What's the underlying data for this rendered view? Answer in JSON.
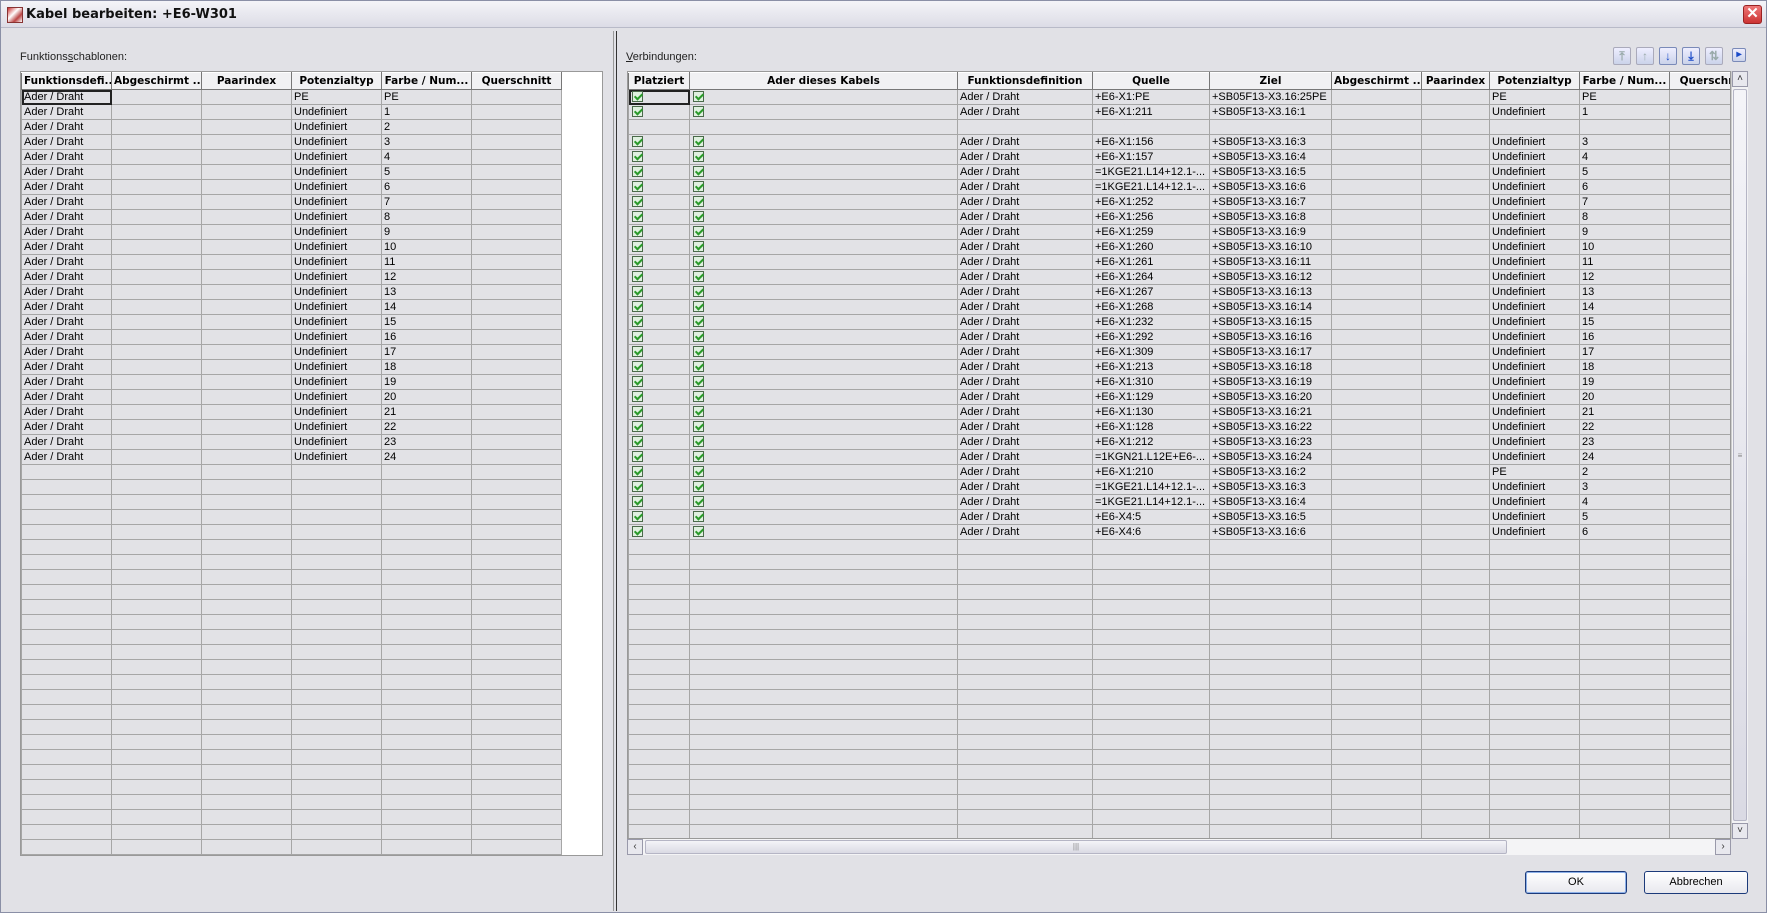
{
  "window": {
    "title": "Kabel bearbeiten: +E6-W301",
    "close_icon": "close-icon"
  },
  "left": {
    "label_pre": "Funktions",
    "label_accel": "s",
    "label_post": "chablonen:",
    "columns": [
      "Funktionsdefi...",
      "Abgeschirmt ...",
      "Paarindex",
      "Potenzialtyp",
      "Farbe / Num...",
      "Querschnitt"
    ],
    "rows": [
      [
        "Ader / Draht",
        "",
        "",
        "PE",
        "PE",
        ""
      ],
      [
        "Ader / Draht",
        "",
        "",
        "Undefiniert",
        "1",
        ""
      ],
      [
        "Ader / Draht",
        "",
        "",
        "Undefiniert",
        "2",
        ""
      ],
      [
        "Ader / Draht",
        "",
        "",
        "Undefiniert",
        "3",
        ""
      ],
      [
        "Ader / Draht",
        "",
        "",
        "Undefiniert",
        "4",
        ""
      ],
      [
        "Ader / Draht",
        "",
        "",
        "Undefiniert",
        "5",
        ""
      ],
      [
        "Ader / Draht",
        "",
        "",
        "Undefiniert",
        "6",
        ""
      ],
      [
        "Ader / Draht",
        "",
        "",
        "Undefiniert",
        "7",
        ""
      ],
      [
        "Ader / Draht",
        "",
        "",
        "Undefiniert",
        "8",
        ""
      ],
      [
        "Ader / Draht",
        "",
        "",
        "Undefiniert",
        "9",
        ""
      ],
      [
        "Ader / Draht",
        "",
        "",
        "Undefiniert",
        "10",
        ""
      ],
      [
        "Ader / Draht",
        "",
        "",
        "Undefiniert",
        "11",
        ""
      ],
      [
        "Ader / Draht",
        "",
        "",
        "Undefiniert",
        "12",
        ""
      ],
      [
        "Ader / Draht",
        "",
        "",
        "Undefiniert",
        "13",
        ""
      ],
      [
        "Ader / Draht",
        "",
        "",
        "Undefiniert",
        "14",
        ""
      ],
      [
        "Ader / Draht",
        "",
        "",
        "Undefiniert",
        "15",
        ""
      ],
      [
        "Ader / Draht",
        "",
        "",
        "Undefiniert",
        "16",
        ""
      ],
      [
        "Ader / Draht",
        "",
        "",
        "Undefiniert",
        "17",
        ""
      ],
      [
        "Ader / Draht",
        "",
        "",
        "Undefiniert",
        "18",
        ""
      ],
      [
        "Ader / Draht",
        "",
        "",
        "Undefiniert",
        "19",
        ""
      ],
      [
        "Ader / Draht",
        "",
        "",
        "Undefiniert",
        "20",
        ""
      ],
      [
        "Ader / Draht",
        "",
        "",
        "Undefiniert",
        "21",
        ""
      ],
      [
        "Ader / Draht",
        "",
        "",
        "Undefiniert",
        "22",
        ""
      ],
      [
        "Ader / Draht",
        "",
        "",
        "Undefiniert",
        "23",
        ""
      ],
      [
        "Ader / Draht",
        "",
        "",
        "Undefiniert",
        "24",
        ""
      ]
    ]
  },
  "right": {
    "label_accel": "V",
    "label_post": "erbindungen:",
    "toolbar": [
      {
        "icon": "move-top-icon",
        "glyph": "⤒",
        "enabled": false
      },
      {
        "icon": "move-up-icon",
        "glyph": "↑",
        "enabled": false
      },
      {
        "icon": "move-down-icon",
        "glyph": "↓",
        "enabled": true
      },
      {
        "icon": "move-bottom-icon",
        "glyph": "⤓",
        "enabled": true
      },
      {
        "icon": "swap-icon",
        "glyph": "⇅",
        "enabled": false
      },
      {
        "icon": "expand-icon",
        "glyph": "▸",
        "enabled": true
      }
    ],
    "columns": [
      "Platziert",
      "Ader dieses Kabels",
      "Funktionsdefinition",
      "Quelle",
      "Ziel",
      "Abgeschirmt ...",
      "Paarindex",
      "Potenzialtyp",
      "Farbe / Num...",
      "Querschnitt"
    ],
    "rows": [
      {
        "platziert": true,
        "ader": true,
        "funk": "Ader / Draht",
        "quelle": "+E6-X1:PE",
        "ziel": "+SB05F13-X3.16:25PE",
        "pot": "PE",
        "farbe": "PE"
      },
      {
        "platziert": true,
        "ader": true,
        "funk": "Ader / Draht",
        "quelle": "+E6-X1:211",
        "ziel": "+SB05F13-X3.16:1",
        "pot": "Undefiniert",
        "farbe": "1"
      },
      {
        "platziert": false,
        "ader": false,
        "funk": "",
        "quelle": "",
        "ziel": "",
        "pot": "",
        "farbe": ""
      },
      {
        "platziert": true,
        "ader": true,
        "funk": "Ader / Draht",
        "quelle": "+E6-X1:156",
        "ziel": "+SB05F13-X3.16:3",
        "pot": "Undefiniert",
        "farbe": "3"
      },
      {
        "platziert": true,
        "ader": true,
        "funk": "Ader / Draht",
        "quelle": "+E6-X1:157",
        "ziel": "+SB05F13-X3.16:4",
        "pot": "Undefiniert",
        "farbe": "4"
      },
      {
        "platziert": true,
        "ader": true,
        "funk": "Ader / Draht",
        "quelle": "=1KGE21.L14+12.1-...",
        "ziel": "+SB05F13-X3.16:5",
        "pot": "Undefiniert",
        "farbe": "5"
      },
      {
        "platziert": true,
        "ader": true,
        "funk": "Ader / Draht",
        "quelle": "=1KGE21.L14+12.1-...",
        "ziel": "+SB05F13-X3.16:6",
        "pot": "Undefiniert",
        "farbe": "6"
      },
      {
        "platziert": true,
        "ader": true,
        "funk": "Ader / Draht",
        "quelle": "+E6-X1:252",
        "ziel": "+SB05F13-X3.16:7",
        "pot": "Undefiniert",
        "farbe": "7"
      },
      {
        "platziert": true,
        "ader": true,
        "funk": "Ader / Draht",
        "quelle": "+E6-X1:256",
        "ziel": "+SB05F13-X3.16:8",
        "pot": "Undefiniert",
        "farbe": "8"
      },
      {
        "platziert": true,
        "ader": true,
        "funk": "Ader / Draht",
        "quelle": "+E6-X1:259",
        "ziel": "+SB05F13-X3.16:9",
        "pot": "Undefiniert",
        "farbe": "9"
      },
      {
        "platziert": true,
        "ader": true,
        "funk": "Ader / Draht",
        "quelle": "+E6-X1:260",
        "ziel": "+SB05F13-X3.16:10",
        "pot": "Undefiniert",
        "farbe": "10"
      },
      {
        "platziert": true,
        "ader": true,
        "funk": "Ader / Draht",
        "quelle": "+E6-X1:261",
        "ziel": "+SB05F13-X3.16:11",
        "pot": "Undefiniert",
        "farbe": "11"
      },
      {
        "platziert": true,
        "ader": true,
        "funk": "Ader / Draht",
        "quelle": "+E6-X1:264",
        "ziel": "+SB05F13-X3.16:12",
        "pot": "Undefiniert",
        "farbe": "12"
      },
      {
        "platziert": true,
        "ader": true,
        "funk": "Ader / Draht",
        "quelle": "+E6-X1:267",
        "ziel": "+SB05F13-X3.16:13",
        "pot": "Undefiniert",
        "farbe": "13"
      },
      {
        "platziert": true,
        "ader": true,
        "funk": "Ader / Draht",
        "quelle": "+E6-X1:268",
        "ziel": "+SB05F13-X3.16:14",
        "pot": "Undefiniert",
        "farbe": "14"
      },
      {
        "platziert": true,
        "ader": true,
        "funk": "Ader / Draht",
        "quelle": "+E6-X1:232",
        "ziel": "+SB05F13-X3.16:15",
        "pot": "Undefiniert",
        "farbe": "15"
      },
      {
        "platziert": true,
        "ader": true,
        "funk": "Ader / Draht",
        "quelle": "+E6-X1:292",
        "ziel": "+SB05F13-X3.16:16",
        "pot": "Undefiniert",
        "farbe": "16"
      },
      {
        "platziert": true,
        "ader": true,
        "funk": "Ader / Draht",
        "quelle": "+E6-X1:309",
        "ziel": "+SB05F13-X3.16:17",
        "pot": "Undefiniert",
        "farbe": "17"
      },
      {
        "platziert": true,
        "ader": true,
        "funk": "Ader / Draht",
        "quelle": "+E6-X1:213",
        "ziel": "+SB05F13-X3.16:18",
        "pot": "Undefiniert",
        "farbe": "18"
      },
      {
        "platziert": true,
        "ader": true,
        "funk": "Ader / Draht",
        "quelle": "+E6-X1:310",
        "ziel": "+SB05F13-X3.16:19",
        "pot": "Undefiniert",
        "farbe": "19"
      },
      {
        "platziert": true,
        "ader": true,
        "funk": "Ader / Draht",
        "quelle": "+E6-X1:129",
        "ziel": "+SB05F13-X3.16:20",
        "pot": "Undefiniert",
        "farbe": "20"
      },
      {
        "platziert": true,
        "ader": true,
        "funk": "Ader / Draht",
        "quelle": "+E6-X1:130",
        "ziel": "+SB05F13-X3.16:21",
        "pot": "Undefiniert",
        "farbe": "21"
      },
      {
        "platziert": true,
        "ader": true,
        "funk": "Ader / Draht",
        "quelle": "+E6-X1:128",
        "ziel": "+SB05F13-X3.16:22",
        "pot": "Undefiniert",
        "farbe": "22"
      },
      {
        "platziert": true,
        "ader": true,
        "funk": "Ader / Draht",
        "quelle": "+E6-X1:212",
        "ziel": "+SB05F13-X3.16:23",
        "pot": "Undefiniert",
        "farbe": "23"
      },
      {
        "platziert": true,
        "ader": true,
        "funk": "Ader / Draht",
        "quelle": "=1KGN21.L12E+E6-...",
        "ziel": "+SB05F13-X3.16:24",
        "pot": "Undefiniert",
        "farbe": "24"
      },
      {
        "platziert": true,
        "ader": true,
        "funk": "Ader / Draht",
        "quelle": "+E6-X1:210",
        "ziel": "+SB05F13-X3.16:2",
        "pot": "PE",
        "farbe": "2"
      },
      {
        "platziert": true,
        "ader": true,
        "funk": "Ader / Draht",
        "quelle": "=1KGE21.L14+12.1-...",
        "ziel": "+SB05F13-X3.16:3",
        "pot": "Undefiniert",
        "farbe": "3"
      },
      {
        "platziert": true,
        "ader": true,
        "funk": "Ader / Draht",
        "quelle": "=1KGE21.L14+12.1-...",
        "ziel": "+SB05F13-X3.16:4",
        "pot": "Undefiniert",
        "farbe": "4"
      },
      {
        "platziert": true,
        "ader": true,
        "funk": "Ader / Draht",
        "quelle": "+E6-X4:5",
        "ziel": "+SB05F13-X3.16:5",
        "pot": "Undefiniert",
        "farbe": "5"
      },
      {
        "platziert": true,
        "ader": true,
        "funk": "Ader / Draht",
        "quelle": "+E6-X4:6",
        "ziel": "+SB05F13-X3.16:6",
        "pot": "Undefiniert",
        "farbe": "6"
      }
    ]
  },
  "buttons": {
    "ok": "OK",
    "cancel": "Abbrechen"
  }
}
